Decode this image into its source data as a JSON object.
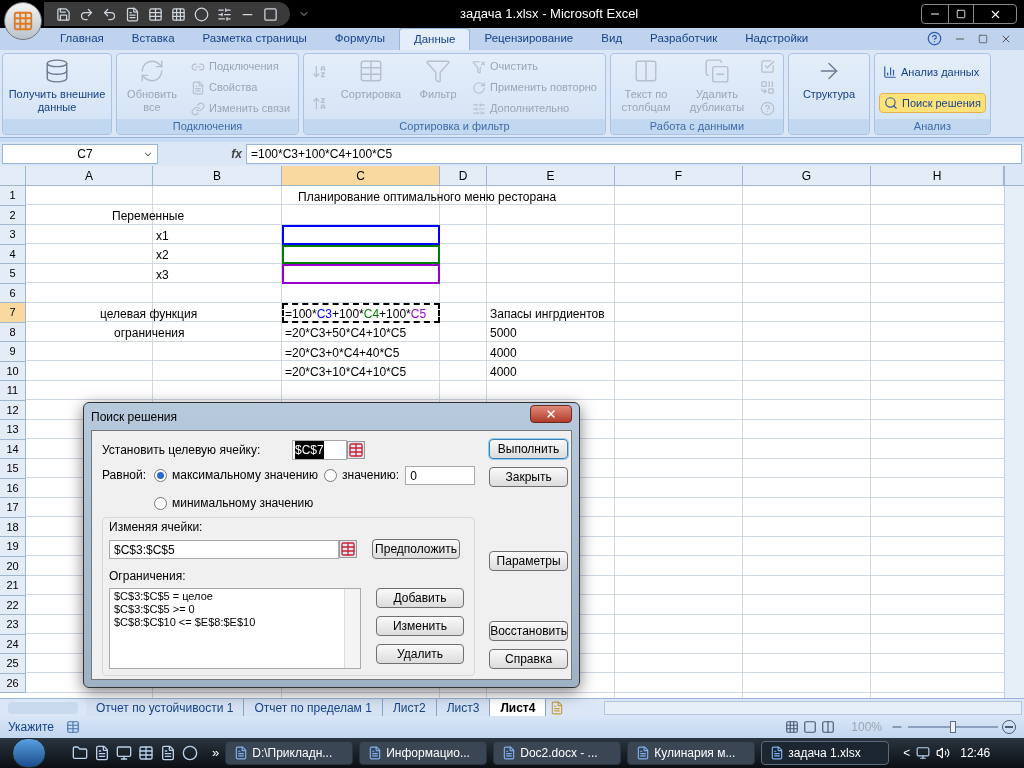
{
  "window": {
    "title": "задача 1.xlsx - Microsoft Excel"
  },
  "tabs": [
    {
      "label": "Главная",
      "selected": false
    },
    {
      "label": "Вставка",
      "selected": false
    },
    {
      "label": "Разметка страницы",
      "selected": false
    },
    {
      "label": "Формулы",
      "selected": false
    },
    {
      "label": "Данные",
      "selected": true
    },
    {
      "label": "Рецензирование",
      "selected": false
    },
    {
      "label": "Вид",
      "selected": false
    },
    {
      "label": "Разработчик",
      "selected": false
    },
    {
      "label": "Надстройки",
      "selected": false
    }
  ],
  "ribbon": [
    {
      "items": [
        {
          "kind": "large",
          "label": "Получить внешние данные",
          "disabled": false
        }
      ]
    },
    {
      "label": "Подключения",
      "items": [
        {
          "kind": "large",
          "label": "Обновить все",
          "disabled": true
        },
        {
          "kind": "small",
          "label": "Подключения",
          "disabled": true
        },
        {
          "kind": "small",
          "label": "Свойства",
          "disabled": true
        },
        {
          "kind": "small",
          "label": "Изменить связи",
          "disabled": true
        }
      ]
    },
    {
      "label": "Сортировка и фильтр",
      "items": [
        {
          "kind": "icon",
          "disabled": true
        },
        {
          "kind": "icon",
          "disabled": true
        },
        {
          "kind": "large",
          "label": "Сортировка",
          "disabled": true
        },
        {
          "kind": "large",
          "label": "Фильтр",
          "disabled": true
        },
        {
          "kind": "small",
          "label": "Очистить",
          "disabled": true
        },
        {
          "kind": "small",
          "label": "Применить повторно",
          "disabled": true
        },
        {
          "kind": "small",
          "label": "Дополнительно",
          "disabled": true
        }
      ]
    },
    {
      "label": "Работа с данными",
      "items": [
        {
          "kind": "large",
          "label": "Текст по столбцам",
          "disabled": true
        },
        {
          "kind": "large",
          "label": "Удалить дубликаты",
          "disabled": true
        },
        {
          "kind": "icon",
          "disabled": true
        },
        {
          "kind": "icon",
          "disabled": true
        },
        {
          "kind": "icon",
          "disabled": true
        }
      ]
    },
    {
      "items": [
        {
          "kind": "large",
          "label": "Структура",
          "disabled": false
        }
      ]
    },
    {
      "label": "Анализ",
      "items": [
        {
          "kind": "small",
          "label": "Анализ данных",
          "disabled": false,
          "selected": false
        },
        {
          "kind": "small",
          "label": "Поиск решения",
          "disabled": false,
          "selected": true
        }
      ]
    }
  ],
  "formula_bar": {
    "name_box": "C7",
    "fx": "fx",
    "formula": "=100*C3+100*C4+100*C5"
  },
  "columns": [
    "A",
    "B",
    "C",
    "D",
    "E",
    "F",
    "G",
    "H"
  ],
  "rows": [
    {
      "number": "1",
      "cells": {
        "C": {
          "text": "Планирование  оптимального меню ресторана"
        }
      }
    },
    {
      "number": "2",
      "cells": {
        "A": {
          "text": "Переменные"
        }
      }
    },
    {
      "number": "3",
      "cells": {
        "B": {
          "text": "x1"
        },
        "C": {
          "color": "#0000ff"
        }
      }
    },
    {
      "number": "4",
      "cells": {
        "B": {
          "text": "x2"
        },
        "C": {
          "color": "#008000"
        }
      }
    },
    {
      "number": "5",
      "cells": {
        "B": {
          "text": "x3"
        },
        "C": {
          "color": "#9900cc"
        }
      }
    },
    {
      "number": "6",
      "cells": {}
    },
    {
      "number": "7",
      "cells": {
        "A": {
          "text": "целевая функция"
        },
        "C": {
          "editing": true,
          "segments": [
            {
              "text": "=100*",
              "color": "#000000"
            },
            {
              "text": "C3",
              "color": "#0000ff"
            },
            {
              "text": "+100*",
              "color": "#000000"
            },
            {
              "text": "C4",
              "color": "#008000"
            },
            {
              "text": "+100*",
              "color": "#000000"
            },
            {
              "text": "C5",
              "color": "#9900cc"
            }
          ]
        },
        "E": {
          "text": "Запасы ингрдиентов"
        }
      }
    },
    {
      "number": "8",
      "cells": {
        "A": {
          "text": "ограничения"
        },
        "C": {
          "text": "=20*C3+50*C4+10*C5"
        },
        "E": {
          "text": "5000"
        }
      }
    },
    {
      "number": "9",
      "cells": {
        "C": {
          "text": "=20*C3+0*C4+40*C5"
        },
        "E": {
          "text": "4000"
        }
      }
    },
    {
      "number": "10",
      "cells": {
        "C": {
          "text": "=20*C3+10*C4+10*C5"
        },
        "E": {
          "text": "4000"
        }
      }
    },
    {
      "number": "11",
      "cells": {}
    },
    {
      "number": "12",
      "cells": {}
    },
    {
      "number": "13",
      "cells": {}
    },
    {
      "number": "14",
      "cells": {}
    },
    {
      "number": "15",
      "cells": {}
    },
    {
      "number": "16",
      "cells": {}
    },
    {
      "number": "17",
      "cells": {}
    },
    {
      "number": "18",
      "cells": {}
    },
    {
      "number": "19",
      "cells": {}
    },
    {
      "number": "20",
      "cells": {}
    },
    {
      "number": "21",
      "cells": {}
    },
    {
      "number": "22",
      "cells": {}
    },
    {
      "number": "23",
      "cells": {}
    },
    {
      "number": "24",
      "cells": {}
    },
    {
      "number": "25",
      "cells": {}
    },
    {
      "number": "26",
      "cells": {}
    }
  ],
  "dialog": {
    "title": "Поиск решения",
    "target_label": "Установить целевую ячейку:",
    "target_value": "$C$7",
    "equal_label": "Равной:",
    "options": [
      {
        "label": "максимальному значению",
        "selected": true
      },
      {
        "label": "значению:",
        "selected": false
      },
      {
        "label": "минимальному значению",
        "selected": false
      }
    ],
    "value_field": "0",
    "changing_label": "Изменяя ячейки:",
    "changing_value": "$C$3:$C$5",
    "guess_button": "Предположить",
    "constraints_label": "Ограничения:",
    "constraints": [
      "$C$3:$C$5 = целое",
      "$C$3:$C$5 >= 0",
      "$C$8:$C$10 <= $E$8:$E$10"
    ],
    "list_buttons": [
      "Добавить",
      "Изменить",
      "Удалить"
    ],
    "side_buttons": [
      {
        "label": "Выполнить",
        "default": true
      },
      {
        "label": "Закрыть",
        "default": false
      },
      {
        "label": "Параметры",
        "default": false
      },
      {
        "label": "Восстановить",
        "default": false
      },
      {
        "label": "Справка",
        "default": false
      }
    ]
  },
  "sheet_tabs": [
    {
      "label": "Отчет по устойчивости 1",
      "selected": false
    },
    {
      "label": "Отчет по пределам 1",
      "selected": false
    },
    {
      "label": "Лист2",
      "selected": false
    },
    {
      "label": "Лист3",
      "selected": false
    },
    {
      "label": "Лист4",
      "selected": true
    }
  ],
  "status_bar": {
    "mode": "Укажите",
    "zoom": "100%",
    "zoom_slider": {
      "level": 0.5
    }
  },
  "taskbar": {
    "tasks": [
      {
        "label": "D:\\Прикладн...",
        "selected": false
      },
      {
        "label": "Информацио...",
        "selected": false
      },
      {
        "label": "Doc2.docx - ...",
        "selected": false
      },
      {
        "label": "Кулинария м...",
        "selected": false
      },
      {
        "label": "задача 1.xlsx",
        "selected": true
      }
    ],
    "overflow": "»",
    "tray_arrow": "<",
    "clock": "12:46"
  }
}
